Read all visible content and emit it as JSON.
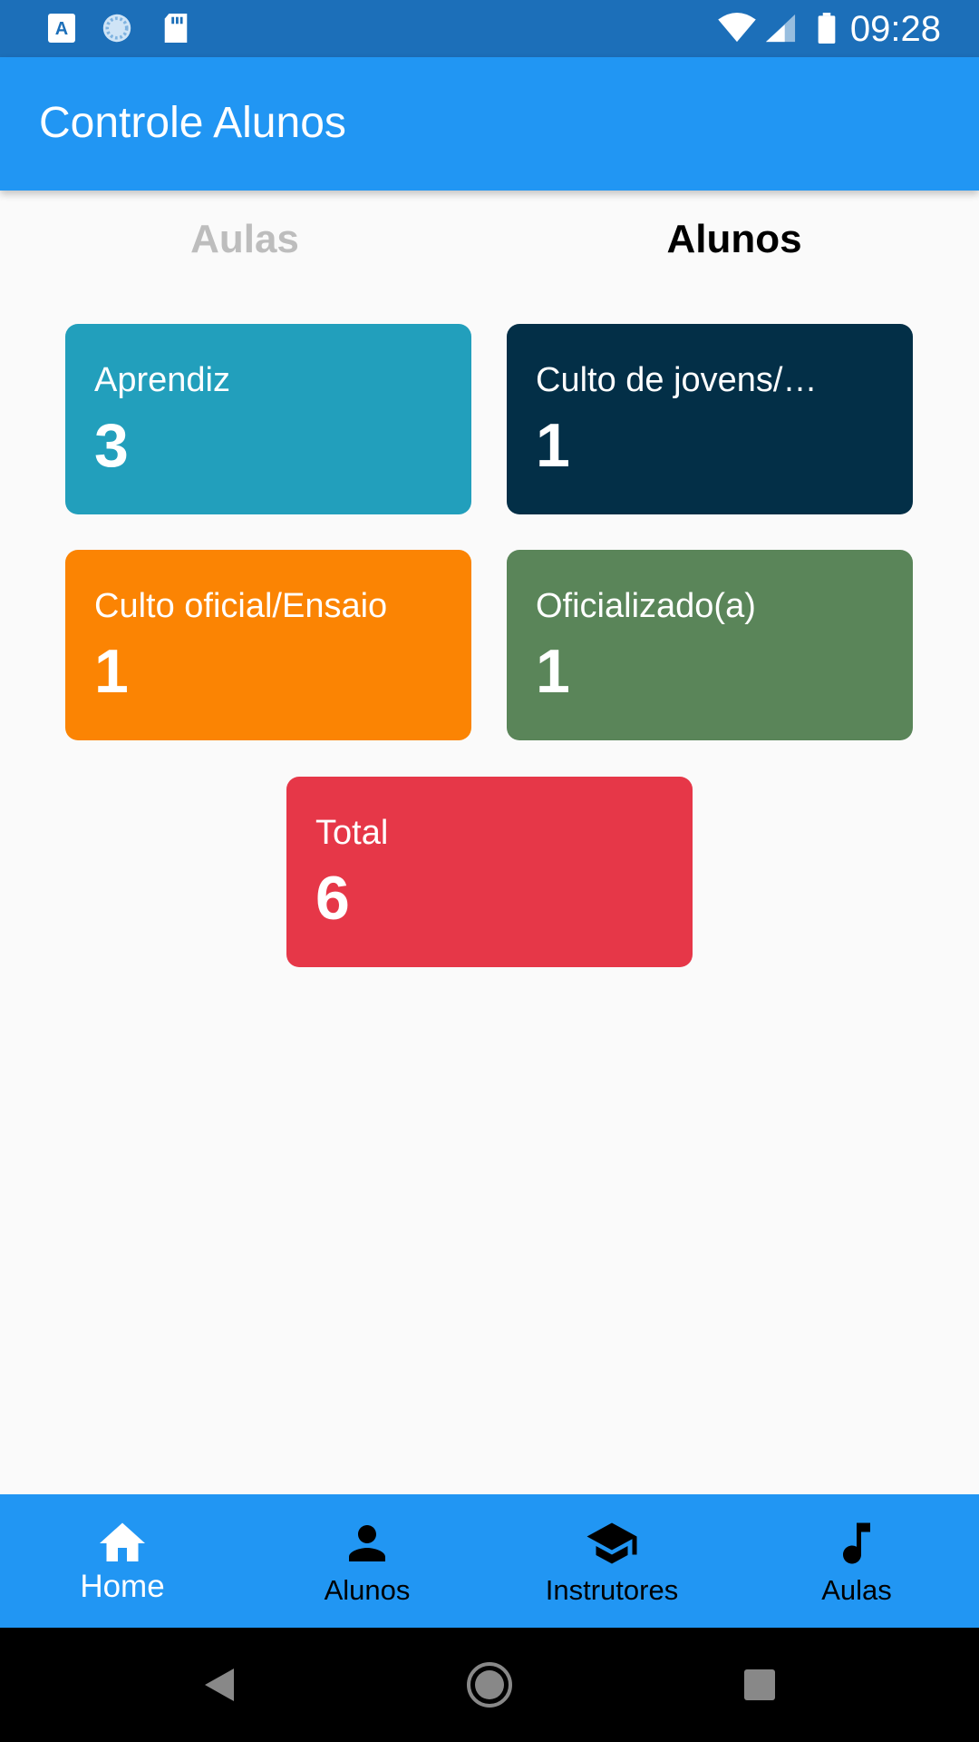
{
  "status_bar": {
    "time": "09:28",
    "left_icons": [
      "translate-a-icon",
      "sync-circle-icon",
      "sd-card-icon"
    ],
    "right_icons": [
      "wifi-icon",
      "signal-icon",
      "battery-icon"
    ]
  },
  "app_bar": {
    "title": "Controle Alunos"
  },
  "tabs": [
    {
      "label": "Aulas",
      "selected": false
    },
    {
      "label": "Alunos",
      "selected": true
    }
  ],
  "cards": [
    {
      "label": "Aprendiz",
      "value": "3",
      "color": "#229fbc"
    },
    {
      "label": "Culto de jovens/…",
      "value": "1",
      "color": "#032f47"
    },
    {
      "label": "Culto oficial/Ensaio",
      "value": "1",
      "color": "#fb8403"
    },
    {
      "label": "Oficializado(a)",
      "value": "1",
      "color": "#5a8559"
    },
    {
      "label": "Total",
      "value": "6",
      "color": "#e63748"
    }
  ],
  "bottom_nav": [
    {
      "label": "Home",
      "icon": "home-icon",
      "selected": true
    },
    {
      "label": "Alunos",
      "icon": "person-icon",
      "selected": false
    },
    {
      "label": "Instrutores",
      "icon": "graduation-cap-icon",
      "selected": false
    },
    {
      "label": "Aulas",
      "icon": "music-note-icon",
      "selected": false
    }
  ],
  "system_nav": [
    "back-icon",
    "home-circle-icon",
    "recents-square-icon"
  ],
  "colors": {
    "status_bar": "#1c6fb9",
    "app_bar": "#2196f3",
    "background": "#fafafa"
  }
}
